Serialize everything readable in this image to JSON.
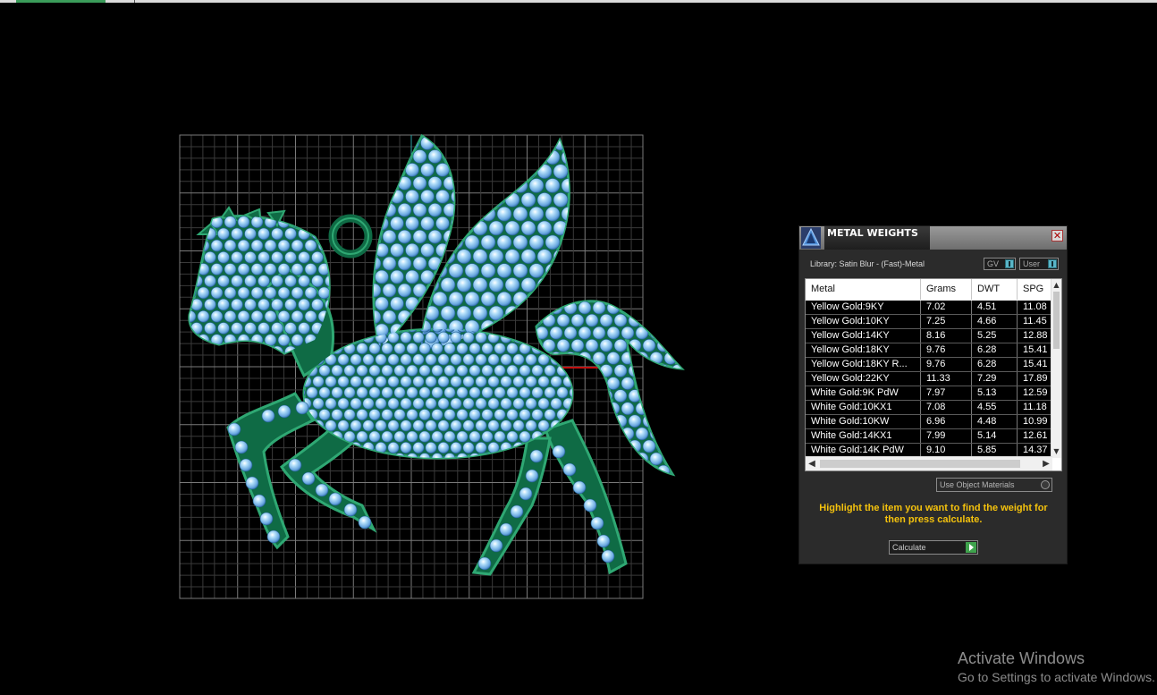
{
  "panel": {
    "title": "METAL WEIGHTS",
    "close_glyph": "✕",
    "library_label": "Library: Satin Blur - (Fast)-Metal",
    "toggle_gv": "GV",
    "toggle_user": "User",
    "columns": [
      "Metal",
      "Grams",
      "DWT",
      "SPG"
    ],
    "rows": [
      {
        "metal": "Yellow Gold:9KY",
        "grams": "7.02",
        "dwt": "4.51",
        "spg": "11.08"
      },
      {
        "metal": "Yellow Gold:10KY",
        "grams": "7.25",
        "dwt": "4.66",
        "spg": "11.45"
      },
      {
        "metal": "Yellow Gold:14KY",
        "grams": "8.16",
        "dwt": "5.25",
        "spg": "12.88"
      },
      {
        "metal": "Yellow Gold:18KY",
        "grams": "9.76",
        "dwt": "6.28",
        "spg": "15.41"
      },
      {
        "metal": "Yellow Gold:18KY R...",
        "grams": "9.76",
        "dwt": "6.28",
        "spg": "15.41"
      },
      {
        "metal": "Yellow Gold:22KY",
        "grams": "11.33",
        "dwt": "7.29",
        "spg": "17.89"
      },
      {
        "metal": "White Gold:9K PdW",
        "grams": "7.97",
        "dwt": "5.13",
        "spg": "12.59"
      },
      {
        "metal": "White Gold:10KX1",
        "grams": "7.08",
        "dwt": "4.55",
        "spg": "11.18"
      },
      {
        "metal": "White Gold:10KW",
        "grams": "6.96",
        "dwt": "4.48",
        "spg": "10.99"
      },
      {
        "metal": "White Gold:14KX1",
        "grams": "7.99",
        "dwt": "5.14",
        "spg": "12.61"
      },
      {
        "metal": "White Gold:14K PdW",
        "grams": "9.10",
        "dwt": "5.85",
        "spg": "14.37"
      }
    ],
    "use_object_materials": "Use Object Materials",
    "hint": "Highlight the item you want to find the weight for then press calculate.",
    "calculate_label": "Calculate"
  },
  "watermark": {
    "title": "Activate Windows",
    "subtitle": "Go to Settings to activate Windows."
  },
  "colors": {
    "grid": "#5a5a5a",
    "metal": "#0f6b45",
    "stone": "#8fc8ee",
    "hint": "#f4c20d"
  },
  "icons": [
    "app-logo-icon",
    "close-icon",
    "scroll-up-icon",
    "scroll-down-icon",
    "scroll-left-icon",
    "scroll-right-icon",
    "play-icon"
  ]
}
